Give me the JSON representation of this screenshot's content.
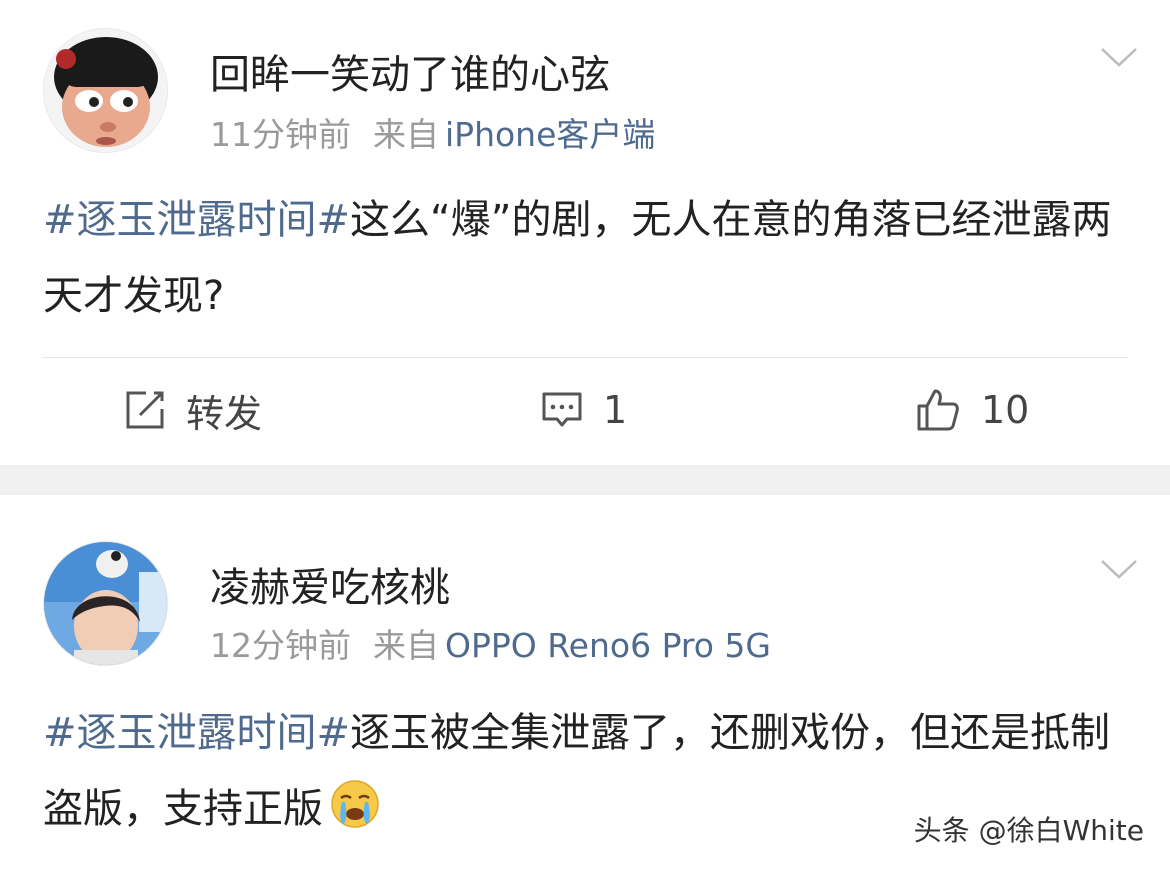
{
  "posts": [
    {
      "username": "回眸一笑动了谁的心弦",
      "time": "11分钟前",
      "from_label": "来自",
      "device": "iPhone客户端",
      "hashtag": "#逐玉泄露时间#",
      "text": "这么“爆”的剧，无人在意的角落已经泄露两天才发现?",
      "actions": {
        "repost_label": "转发",
        "comment_count": "1",
        "like_count": "10"
      }
    },
    {
      "username": "凌赫爱吃核桃",
      "time": "12分钟前",
      "from_label": "来自",
      "device": "OPPO Reno6 Pro 5G",
      "hashtag": "#逐玉泄露时间#",
      "text": "逐玉被全集泄露了，还删戏份，但还是抵制盗版，支持正版"
    }
  ],
  "watermark": "头条 @徐白White",
  "colors": {
    "link": "#4f6a8f",
    "muted": "#9a9a9a",
    "separator": "#f0f0f0"
  },
  "icons": [
    "chevron-down-icon",
    "repost-icon",
    "comment-icon",
    "like-icon",
    "crying-emoji-icon"
  ]
}
